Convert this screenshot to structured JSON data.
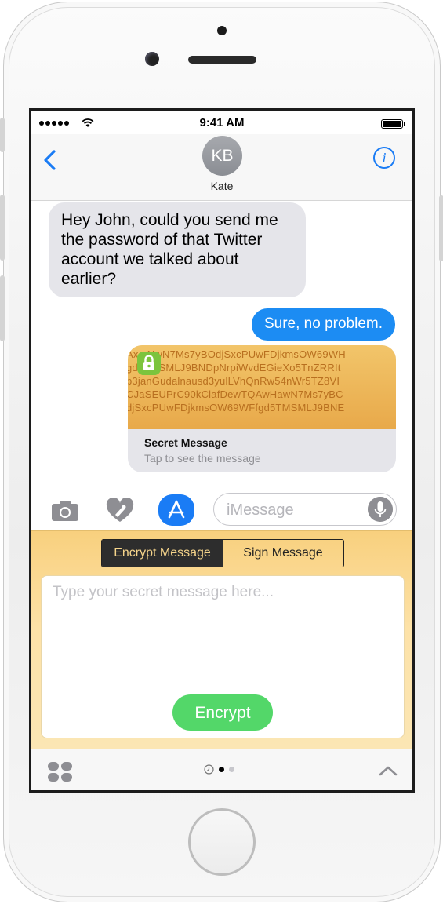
{
  "status": {
    "time": "9:41 AM"
  },
  "header": {
    "avatar_initials": "KB",
    "contact_name": "Kate",
    "info_glyph": "i"
  },
  "messages": {
    "incoming": "Hey John, could you send me the password of that Twitter account we talked about earlier?",
    "outgoing": "Sure, no problem.",
    "secret_cipher_lines": [
      "AxcrNwN7Ms7yBOdjSxcPUwFDjkmsOW69WH",
      "gd5TMSMLJ9BNDpNrpiWvdEGieXo5TnZRRIt",
      "p3janGudalnausd3yulLVhQnRw54nWr5TZ8VI",
      " CJaSEUPrC90kClafDewTQAwHawN7Ms7yBC",
      "djSxcPUwFDjkmsOW69WFfgd5TMSMLJ9BNE"
    ],
    "secret_title": "Secret Message",
    "secret_subtitle": "Tap to see the message"
  },
  "compose": {
    "placeholder": "iMessage"
  },
  "extension": {
    "tabs": [
      "Encrypt Message",
      "Sign Message"
    ],
    "active_tab": "Encrypt Message",
    "placeholder": "Type your secret message here...",
    "encrypt_label": "Encrypt"
  },
  "colors": {
    "accent": "#1a7cf5",
    "outgoing_bubble": "#1c8cf3",
    "incoming_bubble": "#e5e5ea",
    "encrypt_button": "#53d769",
    "extension_bg": "#fde2a8"
  },
  "icons": {
    "back": "chevron-left-icon",
    "info": "info-icon",
    "camera": "camera-icon",
    "digital_touch": "heart-hand-icon",
    "app_store": "app-store-icon",
    "mic": "microphone-icon",
    "lock": "lock-icon",
    "apps": "app-grid-icon",
    "recents": "clock-icon",
    "expand": "chevron-up-icon"
  }
}
